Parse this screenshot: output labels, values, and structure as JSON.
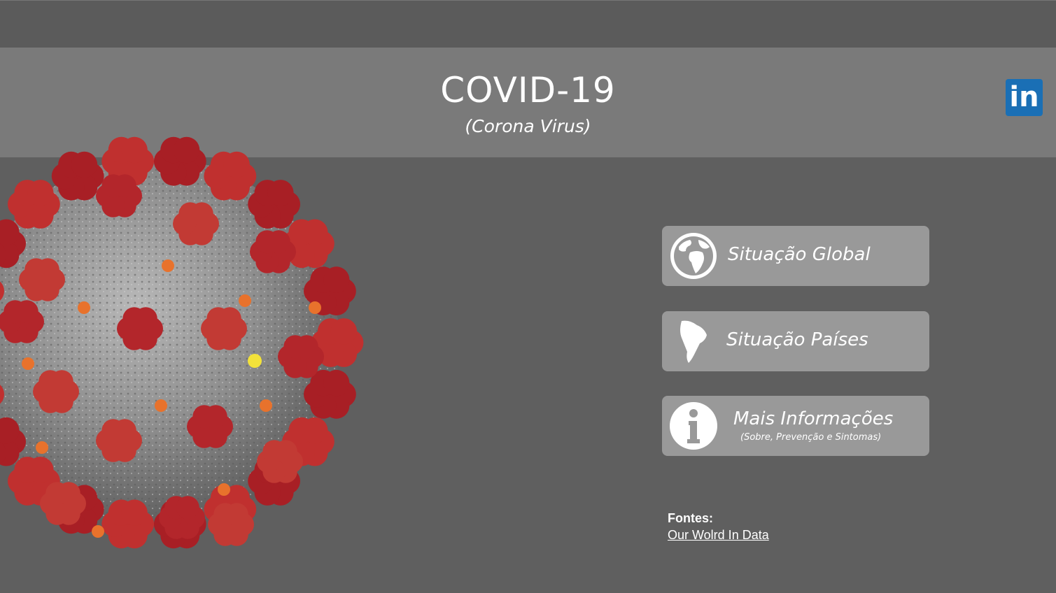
{
  "header": {
    "title": "COVID-19",
    "subtitle": "(Corona Virus)"
  },
  "social": {
    "linkedin_text": "in",
    "icon": "linkedin-icon",
    "color": "#1a6fb5"
  },
  "nav": {
    "buttons": [
      {
        "label": "Situação Global",
        "icon": "globe-icon"
      },
      {
        "label": "Situação Países",
        "icon": "south-america-icon"
      },
      {
        "label": "Mais Informações",
        "sub": "(Sobre, Prevenção e Sintomas)",
        "icon": "info-icon"
      }
    ]
  },
  "sources": {
    "label": "Fontes:",
    "link": "Our Wolrd In Data"
  },
  "colors": {
    "background": "#5f5f5f",
    "header_band": "#7a7a7a",
    "button": "#999999",
    "virus_spike": "#b3262b",
    "virus_body": "#9c9c9c"
  }
}
